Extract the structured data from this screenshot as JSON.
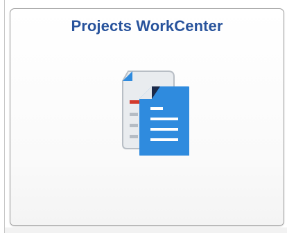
{
  "tile": {
    "title": "Projects WorkCenter",
    "icon": "documents-icon"
  },
  "colors": {
    "title": "#28539c",
    "icon_primary": "#2f8bde",
    "icon_secondary": "#e7eaee",
    "icon_accent_red": "#d33a2c",
    "icon_corner_dark": "#1b2a4a"
  }
}
